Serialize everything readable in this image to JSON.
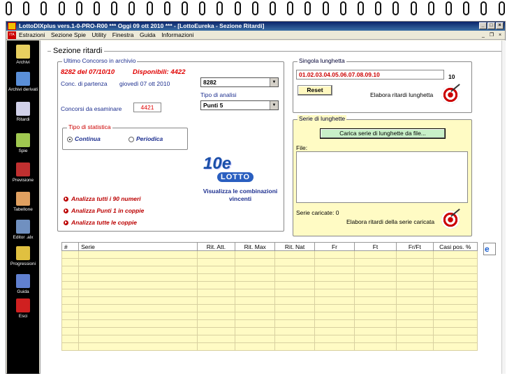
{
  "titlebar": {
    "title": "LottoDIXplus vers.1-0-PRO-R00  ***  Oggi 09 ott 2010  ***  - [LottoEureka - Sezione Ritardi]",
    "min": "_",
    "max": "□",
    "close": "×"
  },
  "menu": [
    "Estrazioni",
    "Sezione Spie",
    "Utility",
    "Finestra",
    "Guida",
    "Informazioni"
  ],
  "mdi_icon": "ITA",
  "sidebar": [
    {
      "label": "Archivi",
      "icon": "pencil-icon",
      "color": "#e8d060"
    },
    {
      "label": "Archivi derivati",
      "icon": "cube-icon",
      "color": "#5a8fd8"
    },
    {
      "label": "Ritardi",
      "icon": "clock-icon",
      "color": "#d0d0e8"
    },
    {
      "label": "Spie",
      "icon": "binoculars-icon",
      "color": "#a0c850"
    },
    {
      "label": "Previsione",
      "icon": "chart-icon",
      "color": "#c03030"
    },
    {
      "label": "Tabellone",
      "icon": "grid-icon",
      "color": "#e0a060"
    },
    {
      "label": "Editor .alx",
      "icon": "editor-icon",
      "color": "#7090c0"
    },
    {
      "label": "Progressioni",
      "icon": "sun-icon",
      "color": "#e0c040"
    },
    {
      "label": "Guida",
      "icon": "book-icon",
      "color": "#6080d0"
    },
    {
      "label": "Esci",
      "icon": "exit-icon",
      "color": "#d02020"
    }
  ],
  "section_title": "Sezione ritardi",
  "archive": {
    "legend": "Ultimo Concorso in archivio",
    "last_draw": "8282 del 07/10/10",
    "available": "Disponibili: 4422",
    "start_label": "Conc. di partenza",
    "start_date": "giovedì 07 ott 2010",
    "start_value": "8282",
    "analysis_label": "Tipo di analisi",
    "analysis_value": "Punti 5",
    "count_label": "Concorsi da esaminare",
    "count_value": "4421"
  },
  "stat": {
    "legend": "Tipo di statistica",
    "opt1": "Continua",
    "opt2": "Periodica"
  },
  "logo": {
    "top": "10e",
    "bottom": "LOTTO"
  },
  "view_combinations": "Visualizza le combinazioni vincenti",
  "actions": [
    "Analizza tutti i 90 numeri",
    "Analizza Punti 1 in coppie",
    "Analizza tutte le coppie"
  ],
  "single": {
    "legend": "Singola lunghetta",
    "value": "01.02.03.04.05.06.07.08.09.10",
    "count": "10",
    "reset": "Reset",
    "elaborate": "Elabora ritardi lunghetta"
  },
  "series": {
    "legend": "Serie di lunghette",
    "load": "Carica serie di lunghette da file...",
    "file_label": "File:",
    "loaded": "Serie caricate: 0",
    "elaborate": "Elabora ritardi della serie caricata"
  },
  "grid_headers": [
    "#",
    "Serie",
    "Rit. Att.",
    "Rit. Max",
    "Rit. Nat",
    "Fr",
    "Ft",
    "Fr/Ft",
    "Casi pos. %"
  ],
  "colors": {
    "titlebar": "#0a246a",
    "panel_yellow": "#fffbc4",
    "accent_red": "#e00000"
  }
}
